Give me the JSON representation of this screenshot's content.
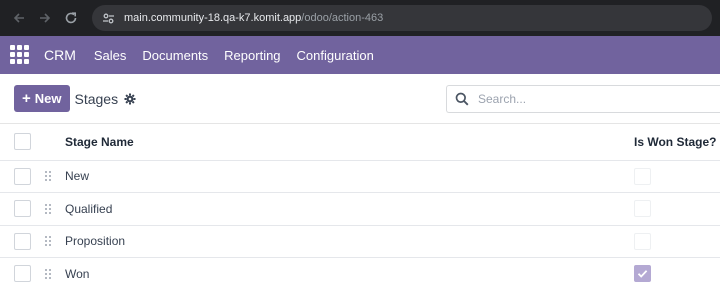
{
  "browser": {
    "url_host": "main.community-18.qa-k7.komit.app",
    "url_path": "/odoo/action-463"
  },
  "topnav": {
    "brand": "CRM",
    "menu": [
      "Sales",
      "Documents",
      "Reporting",
      "Configuration"
    ]
  },
  "control_panel": {
    "new_label": "New",
    "breadcrumb": "Stages",
    "search_placeholder": "Search..."
  },
  "table": {
    "columns": {
      "stage_name": "Stage Name",
      "is_won": "Is Won Stage?"
    },
    "rows": [
      {
        "name": "New",
        "is_won": false
      },
      {
        "name": "Qualified",
        "is_won": false
      },
      {
        "name": "Proposition",
        "is_won": false
      },
      {
        "name": "Won",
        "is_won": true
      }
    ]
  },
  "colors": {
    "brand": "#71639e",
    "won_check": "#b4a9d3"
  }
}
